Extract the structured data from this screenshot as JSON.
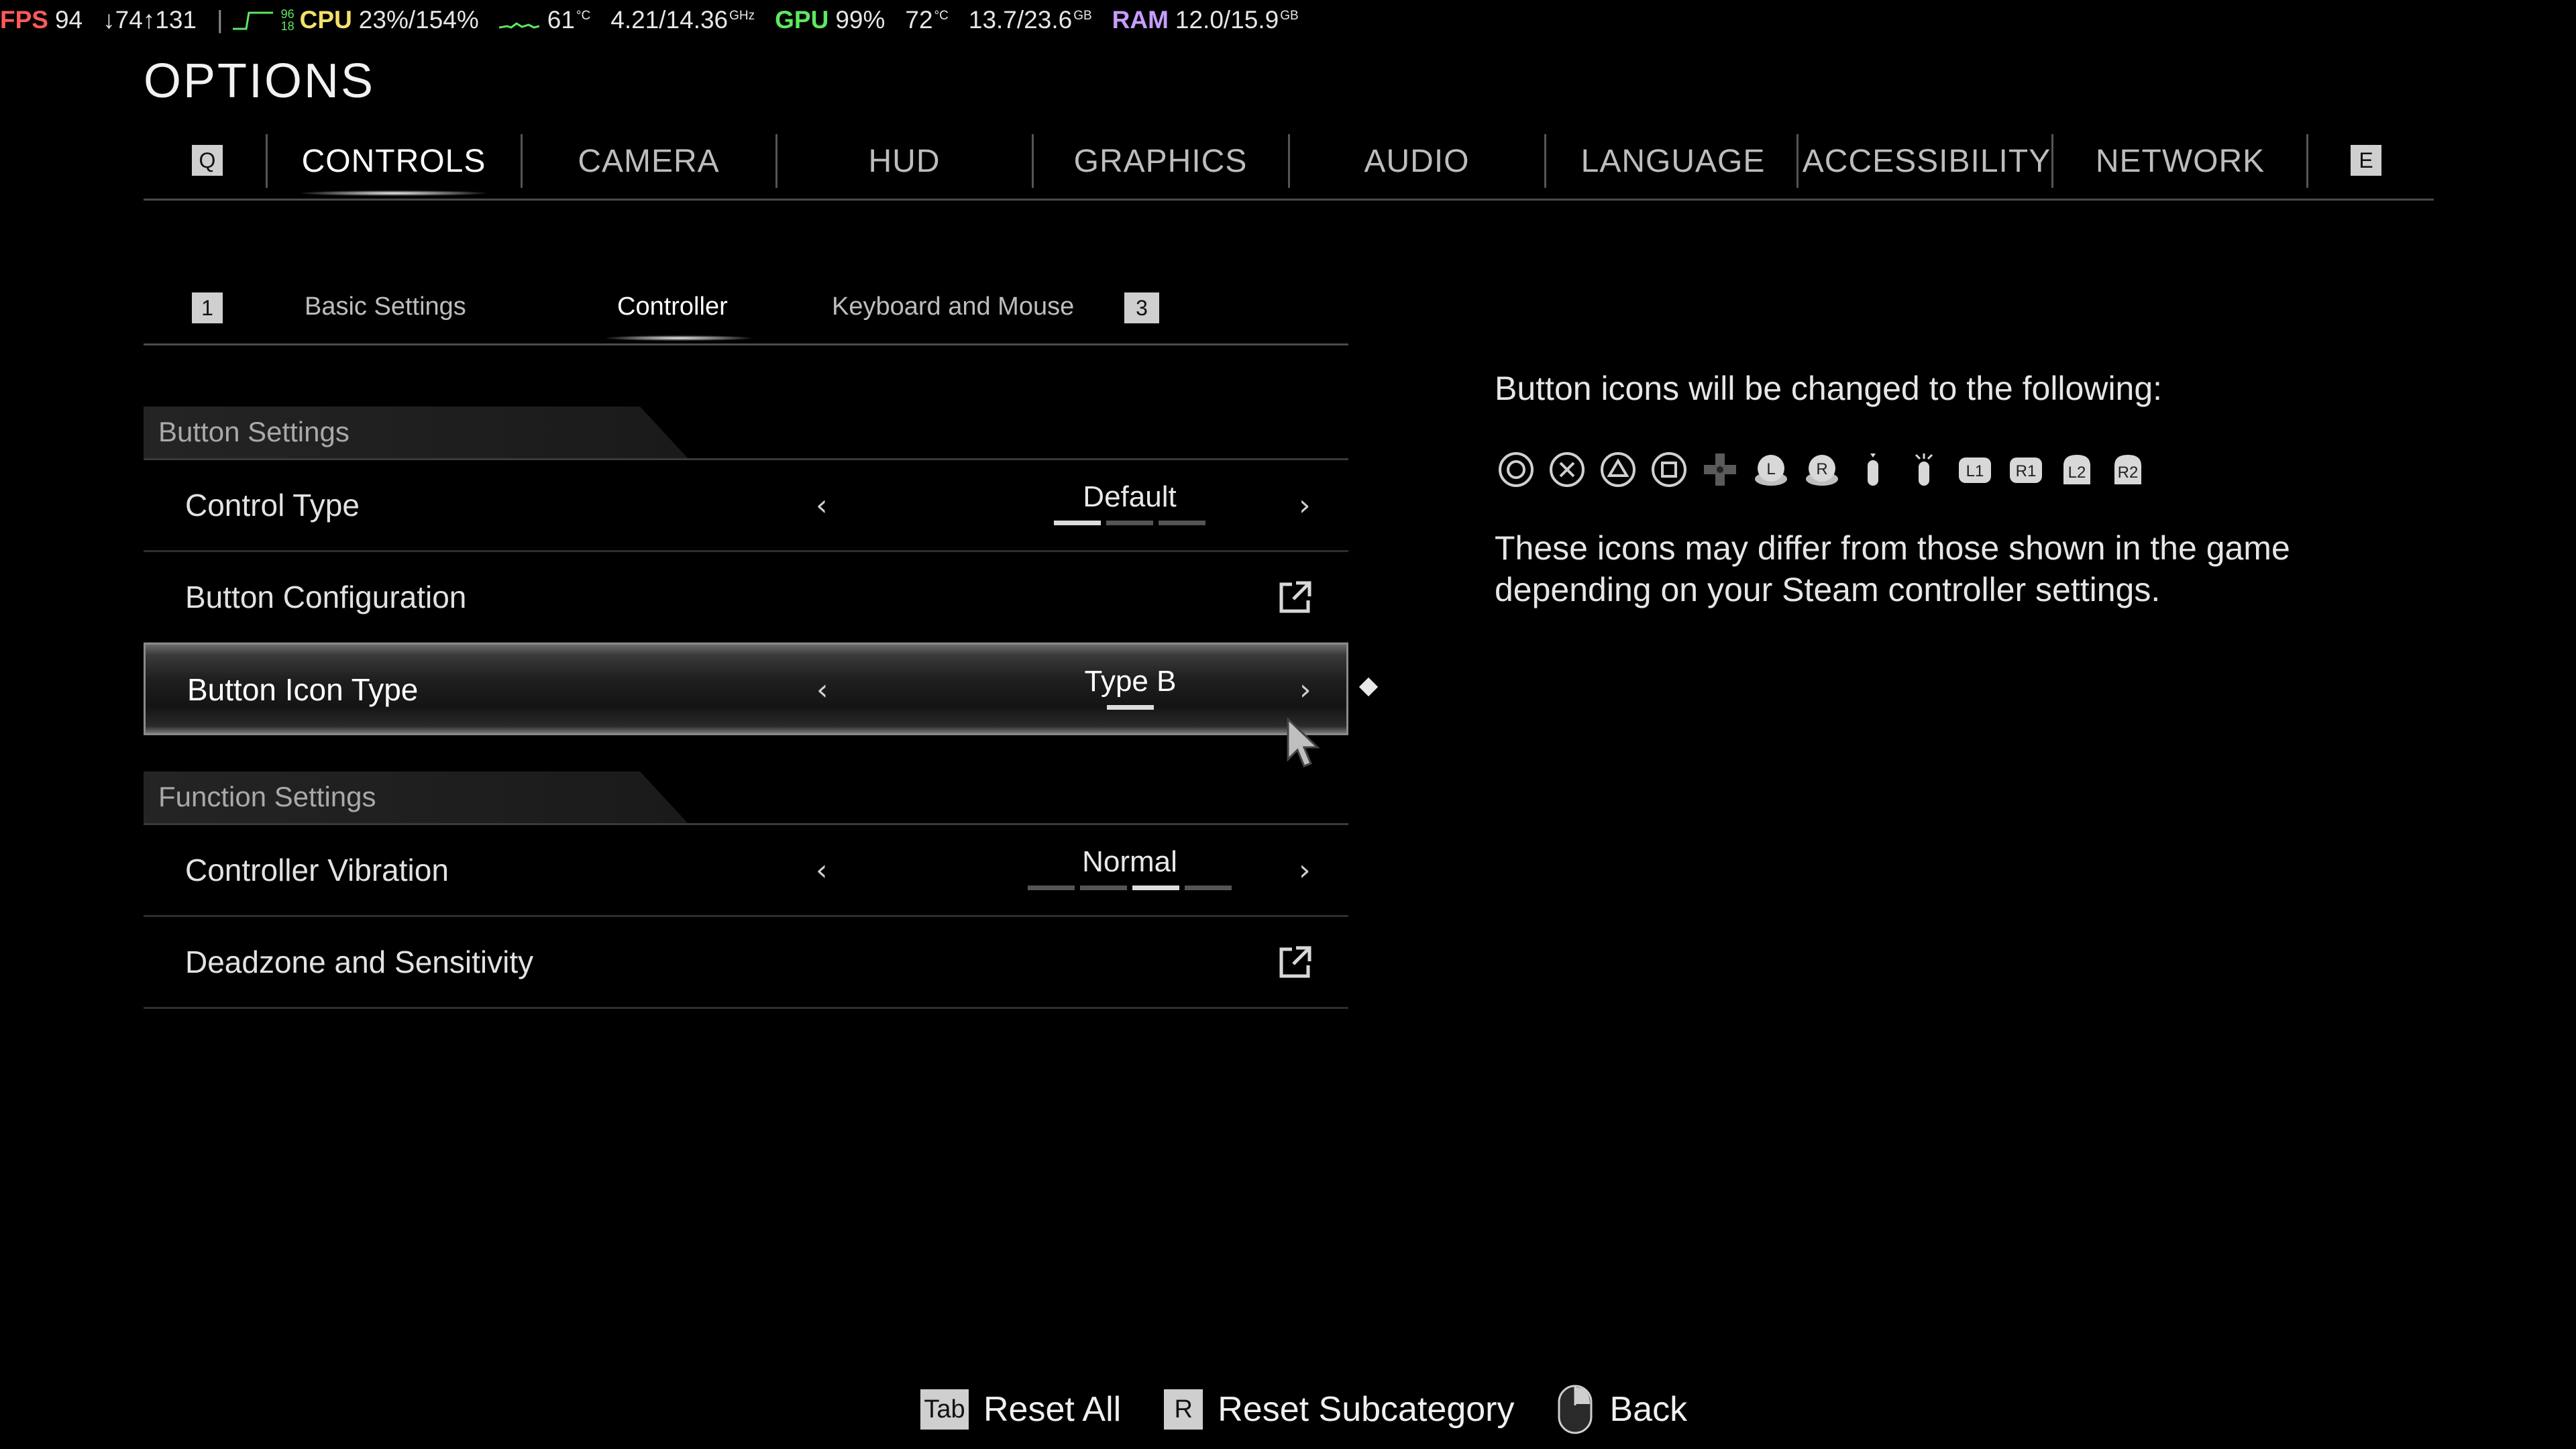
{
  "overlay": {
    "fps_label": "FPS",
    "fps_value": "94",
    "net_down": "↓74",
    "net_up": "↑131",
    "cpu_stack_top": "96",
    "cpu_stack_bottom": "18",
    "cpu_label": "CPU",
    "cpu_value": "23%/154%",
    "cpu_temp": "61",
    "cpu_temp_unit": "°C",
    "cpu_clock": "4.21/14.36",
    "cpu_clock_unit": "GHz",
    "gpu_label": "GPU",
    "gpu_value": "99%",
    "gpu_temp": "72",
    "gpu_temp_unit": "°C",
    "vram": "13.7/23.6",
    "vram_unit": "GB",
    "ram_label": "RAM",
    "ram_value": "12.0/15.9",
    "ram_unit": "GB"
  },
  "title": "OPTIONS",
  "top_tabs": {
    "prev_key": "Q",
    "next_key": "E",
    "items": [
      "CONTROLS",
      "CAMERA",
      "HUD",
      "GRAPHICS",
      "AUDIO",
      "LANGUAGE",
      "ACCESSIBILITY",
      "NETWORK"
    ],
    "active": "CONTROLS"
  },
  "sub_tabs": {
    "prev_key": "1",
    "next_key": "3",
    "items": [
      "Basic Settings",
      "Controller",
      "Keyboard and Mouse"
    ],
    "active": "Controller"
  },
  "sections": [
    {
      "header": "Button Settings",
      "rows": [
        {
          "label": "Control Type",
          "type": "selector",
          "value": "Default",
          "option_count": 3,
          "option_index": 1
        },
        {
          "label": "Button Configuration",
          "type": "link",
          "icon": "external-link-icon"
        },
        {
          "label": "Button Icon Type",
          "type": "selector",
          "value": "Type B",
          "option_count": 1,
          "option_index": 1,
          "selected": true
        }
      ]
    },
    {
      "header": "Function Settings",
      "rows": [
        {
          "label": "Controller Vibration",
          "type": "selector",
          "value": "Normal",
          "option_count": 4,
          "option_index": 3
        },
        {
          "label": "Deadzone and Sensitivity",
          "type": "link",
          "icon": "external-link-icon"
        }
      ]
    }
  ],
  "arrows": {
    "left": "‹",
    "right": "›"
  },
  "info": {
    "title": "Button icons will be changed to the following:",
    "icons": [
      "circle-button-icon",
      "cross-button-icon",
      "triangle-button-icon",
      "square-button-icon",
      "dpad-icon",
      "left-stick-icon",
      "right-stick-icon",
      "stick-press-icon",
      "stick-move-icon",
      "l1-button-icon",
      "r1-button-icon",
      "l2-button-icon",
      "r2-button-icon"
    ],
    "icon_texts": {
      "l1": "L1",
      "r1": "R1",
      "l2": "L2",
      "r2": "R2",
      "l": "L",
      "r": "R"
    },
    "description": "These icons may differ from those shown in the game depending on your Steam controller settings."
  },
  "bottom": {
    "reset_all_key": "Tab",
    "reset_all_label": "Reset All",
    "reset_sub_key": "R",
    "reset_sub_label": "Reset Subcategory",
    "back_label": "Back"
  },
  "colors": {
    "background": "#000000",
    "fps": "#ff5a5a",
    "cpu": "#f5e06a",
    "gpu": "#5ee85e",
    "ram": "#c89cff",
    "key_badge": "#cfcfcf"
  }
}
